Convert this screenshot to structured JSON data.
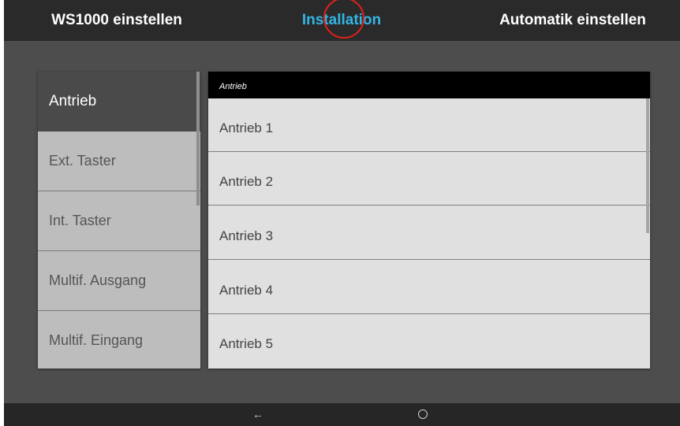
{
  "top_tabs": [
    {
      "label": "WS1000 einstellen",
      "active": false
    },
    {
      "label": "Installation",
      "active": true
    },
    {
      "label": "Automatik einstellen",
      "active": false
    }
  ],
  "colors": {
    "active_tab": "#33b5e5",
    "touch_marker": "#e0201b"
  },
  "categories": [
    {
      "label": "Antrieb",
      "selected": true
    },
    {
      "label": "Ext. Taster",
      "selected": false
    },
    {
      "label": "Int. Taster",
      "selected": false
    },
    {
      "label": "Multif. Ausgang",
      "selected": false
    },
    {
      "label": "Multif. Eingang",
      "selected": false
    }
  ],
  "list": {
    "header": "Antrieb",
    "items": [
      "Antrieb 1",
      "Antrieb 2",
      "Antrieb 3",
      "Antrieb 4",
      "Antrieb 5"
    ]
  },
  "navbar": {
    "back_icon": "←",
    "home_icon": "home-circle"
  }
}
